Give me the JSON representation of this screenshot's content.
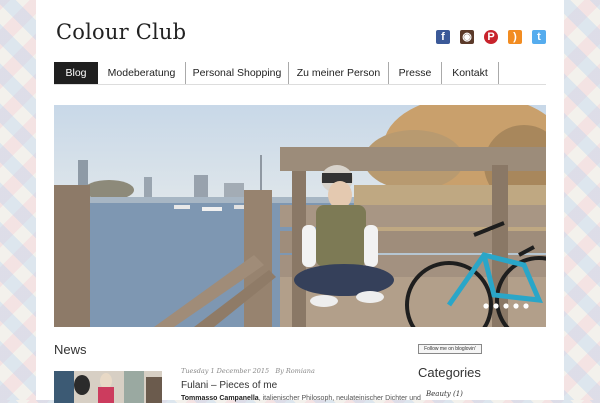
{
  "site": {
    "title": "Colour Club"
  },
  "social": [
    {
      "name": "facebook-icon",
      "glyph": "f",
      "color": "#3b5998"
    },
    {
      "name": "instagram-icon",
      "glyph": "◉",
      "color": "#5b3a29"
    },
    {
      "name": "pinterest-icon",
      "glyph": "P",
      "color": "#c8232c"
    },
    {
      "name": "rss-icon",
      "glyph": ")",
      "color": "#f28c21"
    },
    {
      "name": "twitter-icon",
      "glyph": "t",
      "color": "#55acee"
    }
  ],
  "nav": {
    "items": [
      {
        "label": "Blog",
        "active": true
      },
      {
        "label": "Modeberatung"
      },
      {
        "label": "Personal Shopping"
      },
      {
        "label": "Zu meiner Person"
      },
      {
        "label": "Presse"
      },
      {
        "label": "Kontakt"
      }
    ]
  },
  "slider": {
    "dot_count": 5
  },
  "news": {
    "heading": "News",
    "post": {
      "date": "Tuesday 1 December 2015",
      "author": "By Romiana",
      "title": "Fulani – Pieces of me",
      "excerpt_strong": "Tommasso Campanella",
      "excerpt_rest": ", italienischer Philosoph, neulateinischer Dichter und"
    }
  },
  "sidebar": {
    "follow_label": "Follow me on bloglovin'",
    "categories_heading": "Categories",
    "category_first": "Beauty (1)"
  }
}
